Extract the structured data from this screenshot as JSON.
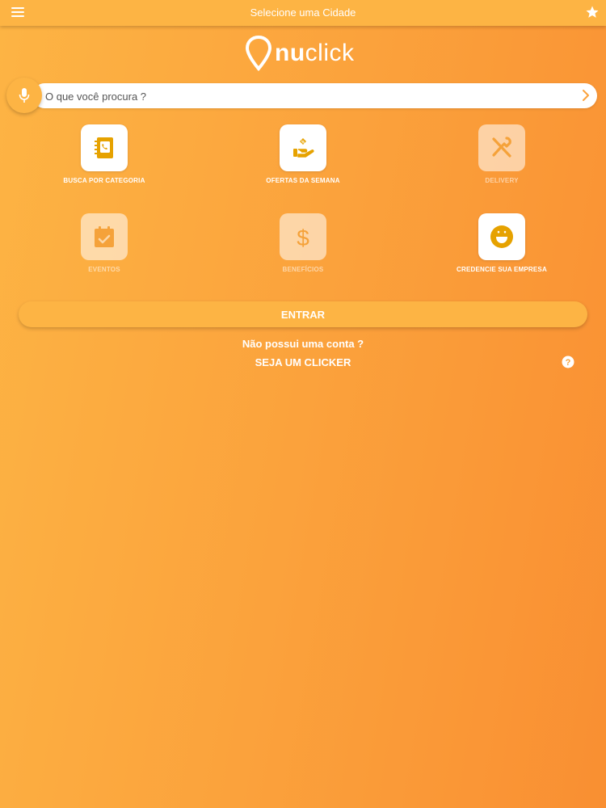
{
  "header": {
    "title": "Selecione uma Cidade"
  },
  "logo": {
    "text_bold": "nu",
    "text_light": "click"
  },
  "search": {
    "placeholder": "O que você procura ?"
  },
  "tiles": [
    {
      "label": "BUSCA POR CATEGORIA",
      "icon": "agenda-icon",
      "enabled": true
    },
    {
      "label": "OFERTAS DA SEMANA",
      "icon": "offer-hand-icon",
      "enabled": true
    },
    {
      "label": "DELIVERY",
      "icon": "delivery-utensils-icon",
      "enabled": false
    },
    {
      "label": "EVENTOS",
      "icon": "calendar-icon",
      "enabled": false
    },
    {
      "label": "BENEFÍCIOS",
      "icon": "dollar-icon",
      "enabled": false
    },
    {
      "label": "CREDENCIE SUA EMPRESA",
      "icon": "smiley-icon",
      "enabled": true
    }
  ],
  "login": {
    "enter_label": "ENTRAR",
    "no_account_text": "Não possui uma conta ?",
    "signup_label": "SEJA UM CLICKER"
  },
  "colors": {
    "accent": "#fdb444",
    "icon_gold": "#e6a200",
    "gradient_end": "#f98f32"
  }
}
